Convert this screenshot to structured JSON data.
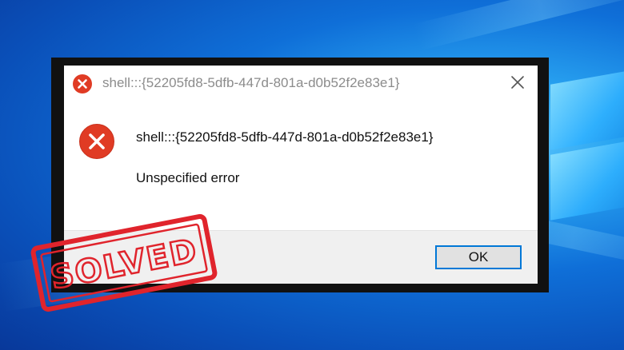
{
  "dialog": {
    "title": "shell:::{52205fd8-5dfb-447d-801a-d0b52f2e83e1}",
    "message_title": "shell:::{52205fd8-5dfb-447d-801a-d0b52f2e83e1}",
    "message_body": "Unspecified error",
    "ok_label": "OK",
    "icons": {
      "title": "error-icon",
      "content": "error-icon",
      "close": "close-icon"
    }
  },
  "stamp": {
    "text": "SOLVED",
    "color": "#e0242c"
  },
  "colors": {
    "error_red": "#e03b24",
    "accent_blue": "#0078d7",
    "desktop_blue": "#0f6fd8"
  }
}
